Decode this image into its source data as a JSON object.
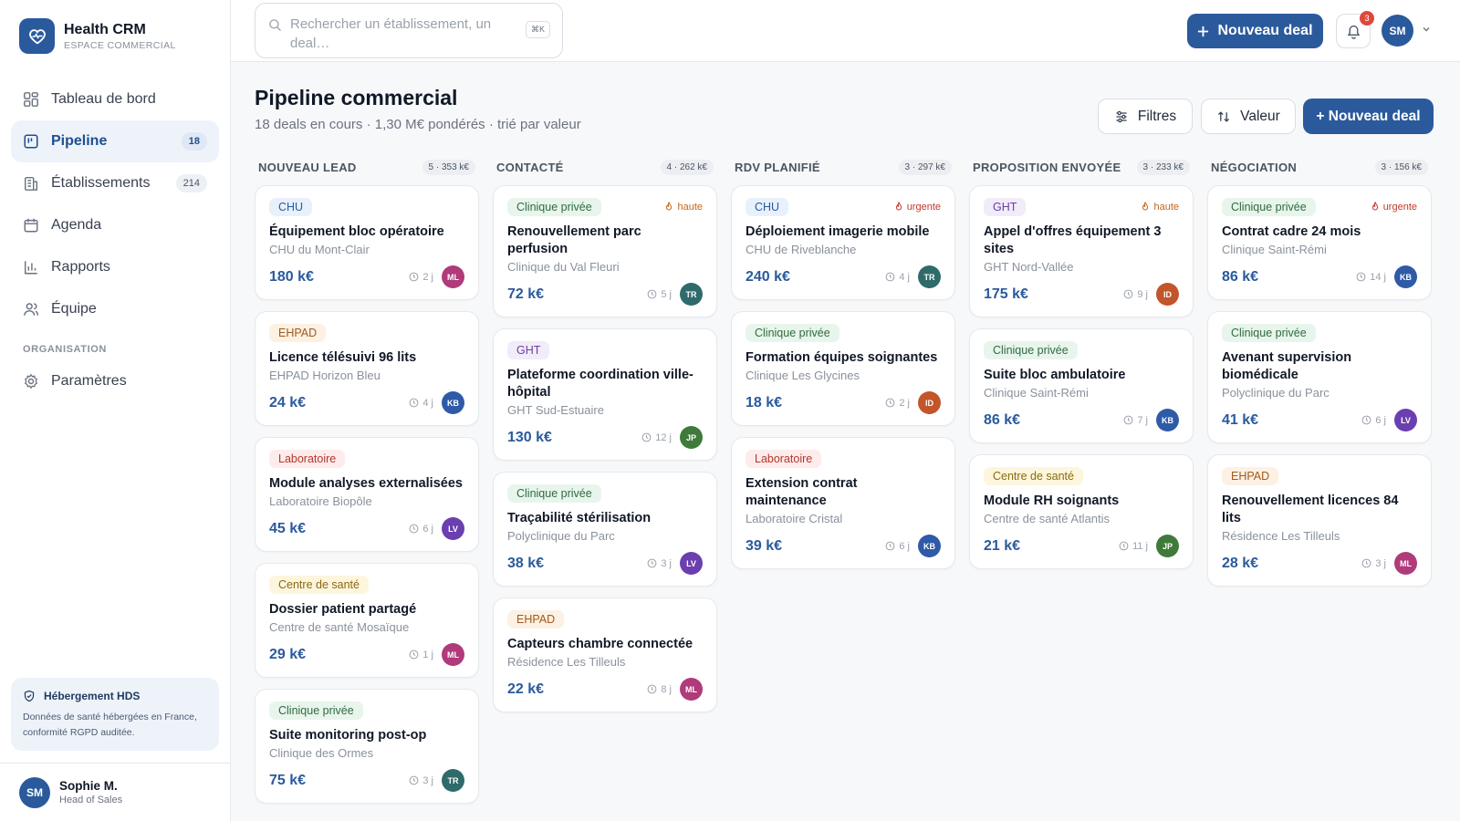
{
  "brand": {
    "name": "Health CRM",
    "subtitle": "ESPACE COMMERCIAL"
  },
  "nav": {
    "items": [
      {
        "label": "Tableau de bord",
        "icon": "dashboard-icon"
      },
      {
        "label": "Pipeline",
        "icon": "pipeline-icon",
        "count": "18",
        "active": true
      },
      {
        "label": "Établissements",
        "icon": "building-icon",
        "count": "214"
      },
      {
        "label": "Agenda",
        "icon": "calendar-icon"
      },
      {
        "label": "Rapports",
        "icon": "chart-icon"
      },
      {
        "label": "Équipe",
        "icon": "team-icon"
      }
    ],
    "section_label": "ORGANISATION",
    "settings_label": "Paramètres"
  },
  "hds": {
    "title": "Hébergement HDS",
    "text": "Données de santé hébergées en France, conformité RGPD auditée."
  },
  "user": {
    "initials": "SM",
    "name": "Sophie M.",
    "role": "Head of Sales"
  },
  "topbar": {
    "search_placeholder": "Rechercher un établissement, un deal…",
    "shortcut": "⌘K",
    "new_deal_label": "Nouveau deal",
    "notifications_count": "3",
    "avatar_initials": "SM"
  },
  "header": {
    "title": "Pipeline commercial",
    "subtitle": "18 deals en cours · 1,30 M€ pondérés · trié par valeur",
    "filters_label": "Filtres",
    "sort_label": "Valeur",
    "new_deal_label": "+ Nouveau deal"
  },
  "colors": {
    "primary": "#2a5a9c",
    "urgent": "#c0392b",
    "high": "#c4651a"
  },
  "columns": [
    {
      "name": "NOUVEAU LEAD",
      "meta": "5 · 353 k€",
      "cards": [
        {
          "tag": "CHU",
          "tag_type": "chu",
          "title": "Équipement bloc opératoire",
          "org": "CHU du Mont-Clair",
          "amount": "180 k€",
          "days": "2 j",
          "owner": "ML"
        },
        {
          "tag": "EHPAD",
          "tag_type": "ehpad",
          "title": "Licence télésuivi 96 lits",
          "org": "EHPAD Horizon Bleu",
          "amount": "24 k€",
          "days": "4 j",
          "owner": "KB"
        },
        {
          "tag": "Laboratoire",
          "tag_type": "labo",
          "title": "Module analyses externalisées",
          "org": "Laboratoire Biopôle",
          "amount": "45 k€",
          "days": "6 j",
          "owner": "LV"
        },
        {
          "tag": "Centre de santé",
          "tag_type": "cs",
          "title": "Dossier patient partagé",
          "org": "Centre de santé Mosaïque",
          "amount": "29 k€",
          "days": "1 j",
          "owner": "ML"
        },
        {
          "tag": "Clinique privée",
          "tag_type": "clinique",
          "title": "Suite monitoring post-op",
          "org": "Clinique des Ormes",
          "amount": "75 k€",
          "days": "3 j",
          "owner": "TR"
        }
      ]
    },
    {
      "name": "CONTACTÉ",
      "meta": "4 · 262 k€",
      "cards": [
        {
          "tag": "Clinique privée",
          "tag_type": "clinique",
          "priority": "haute",
          "priority_type": "haute",
          "title": "Renouvellement parc perfusion",
          "org": "Clinique du Val Fleuri",
          "amount": "72 k€",
          "days": "5 j",
          "owner": "TR"
        },
        {
          "tag": "GHT",
          "tag_type": "ght",
          "title": "Plateforme coordination ville-hôpital",
          "org": "GHT Sud-Estuaire",
          "amount": "130 k€",
          "days": "12 j",
          "owner": "JP"
        },
        {
          "tag": "Clinique privée",
          "tag_type": "clinique",
          "title": "Traçabilité stérilisation",
          "org": "Polyclinique du Parc",
          "amount": "38 k€",
          "days": "3 j",
          "owner": "LV"
        },
        {
          "tag": "EHPAD",
          "tag_type": "ehpad",
          "title": "Capteurs chambre connectée",
          "org": "Résidence Les Tilleuls",
          "amount": "22 k€",
          "days": "8 j",
          "owner": "ML"
        }
      ]
    },
    {
      "name": "RDV PLANIFIÉ",
      "meta": "3 · 297 k€",
      "cards": [
        {
          "tag": "CHU",
          "tag_type": "chu",
          "priority": "urgente",
          "priority_type": "urgente",
          "title": "Déploiement imagerie mobile",
          "org": "CHU de Riveblanche",
          "amount": "240 k€",
          "days": "4 j",
          "owner": "TR"
        },
        {
          "tag": "Clinique privée",
          "tag_type": "clinique",
          "title": "Formation équipes soignantes",
          "org": "Clinique Les Glycines",
          "amount": "18 k€",
          "days": "2 j",
          "owner": "ID"
        },
        {
          "tag": "Laboratoire",
          "tag_type": "labo",
          "title": "Extension contrat maintenance",
          "org": "Laboratoire Cristal",
          "amount": "39 k€",
          "days": "6 j",
          "owner": "KB"
        }
      ]
    },
    {
      "name": "PROPOSITION ENVOYÉE",
      "meta": "3 · 233 k€",
      "cards": [
        {
          "tag": "GHT",
          "tag_type": "ght",
          "priority": "haute",
          "priority_type": "haute",
          "title": "Appel d'offres équipement 3 sites",
          "org": "GHT Nord-Vallée",
          "amount": "175 k€",
          "days": "9 j",
          "owner": "ID"
        },
        {
          "tag": "Clinique privée",
          "tag_type": "clinique",
          "title": "Suite bloc ambulatoire",
          "org": "Clinique Saint-Rémi",
          "amount": "86 k€",
          "days": "7 j",
          "owner": "KB"
        },
        {
          "tag": "Centre de santé",
          "tag_type": "cs",
          "title": "Module RH soignants",
          "org": "Centre de santé Atlantis",
          "amount": "21 k€",
          "days": "11 j",
          "owner": "JP"
        }
      ]
    },
    {
      "name": "NÉGOCIATION",
      "meta": "3 · 156 k€",
      "cards": [
        {
          "tag": "Clinique privée",
          "tag_type": "clinique",
          "priority": "urgente",
          "priority_type": "urgente",
          "title": "Contrat cadre 24 mois",
          "org": "Clinique Saint-Rémi",
          "amount": "86 k€",
          "days": "14 j",
          "owner": "KB"
        },
        {
          "tag": "Clinique privée",
          "tag_type": "clinique",
          "title": "Avenant supervision biomédicale",
          "org": "Polyclinique du Parc",
          "amount": "41 k€",
          "days": "6 j",
          "owner": "LV"
        },
        {
          "tag": "EHPAD",
          "tag_type": "ehpad",
          "title": "Renouvellement licences 84 lits",
          "org": "Résidence Les Tilleuls",
          "amount": "28 k€",
          "days": "3 j",
          "owner": "ML"
        }
      ]
    }
  ],
  "owner_colors": {
    "ML": "#b03a7a",
    "KB": "#2f5aa8",
    "LV": "#6a3fb0",
    "TR": "#2f6b6b",
    "JP": "#3f7a3a",
    "ID": "#c2552a"
  }
}
